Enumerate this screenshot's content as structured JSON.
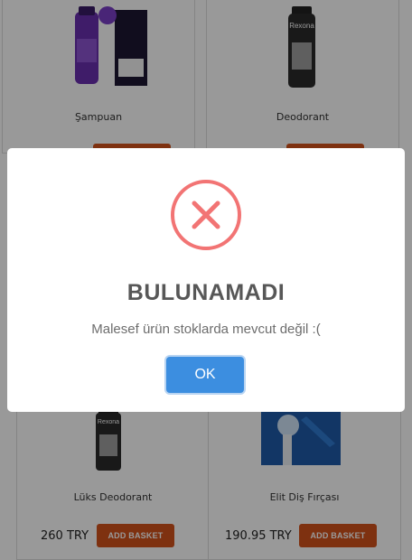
{
  "currency": "TRY",
  "products": [
    {
      "name": "Şampuan",
      "price": "",
      "button": "ADD BASKET",
      "image": "shampoo-bottle-image"
    },
    {
      "name": "Deodorant",
      "price": "",
      "button": "ADD BASKET",
      "image": "deodorant-can-image"
    },
    {
      "name": "Lüks Deodorant",
      "price": "260 TRY",
      "button": "ADD BASKET",
      "image": "deodorant-can-image"
    },
    {
      "name": "Elit Diş Fırçası",
      "price": "190.95 TRY",
      "button": "ADD BASKET",
      "image": "toothbrush-image"
    }
  ],
  "modal": {
    "title": "BULUNAMADI",
    "message": "Malesef ürün stoklarda mevcut değil :(",
    "ok_label": "OK",
    "icon": "error-x-icon",
    "icon_color": "#f27474",
    "ok_color": "#3c8ee0"
  },
  "colors": {
    "add_button": "#d2521c",
    "overlay": "rgba(0,0,0,0.4)"
  }
}
